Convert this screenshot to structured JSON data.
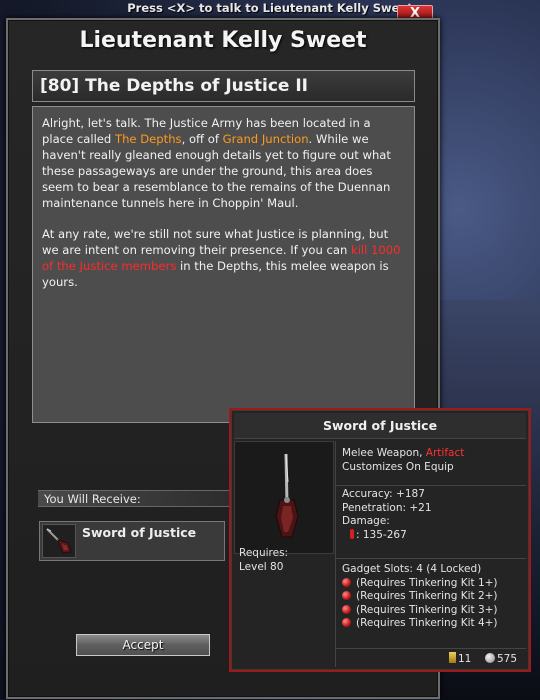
{
  "hint": "Press <X> to talk to Lieutenant Kelly Sweet",
  "close_label": "X",
  "npc_name": "Lieutenant Kelly Sweet",
  "mission": {
    "title": "[80] The Depths of Justice II",
    "para1_a": "Alright, let's talk. The Justice Army has been located in a place called ",
    "para1_loc1": "The Depths",
    "para1_b": ", off of ",
    "para1_loc2": "Grand Junction",
    "para1_c": ". While we haven't really gleaned enough details yet to figure out what these passageways are under the ground, this area does seem to bear a resemblance to the remains of the Duennan maintenance tunnels here in Choppin' Maul.",
    "para2_a": "At any rate, we're still not sure what Justice is planning, but we are intent on removing their presence. If you can ",
    "para2_objective": "kill 1000 of the Justice members",
    "para2_b": " in the Depths, this melee weapon is yours."
  },
  "reward": {
    "section_label": "You Will Receive:",
    "item_name": "Sword of Justice",
    "icon": "sword-icon"
  },
  "accept_label": "Accept",
  "tooltip": {
    "title": "Sword of Justice",
    "type_prefix": "Melee Weapon, ",
    "rarity": "Artifact",
    "customize": "Customizes On Equip",
    "accuracy": "Accuracy: +187",
    "penetration": "Penetration: +21",
    "damage_label": "Damage:",
    "damage_value": ": 135-267",
    "requires_label": "Requires:",
    "requires_value": "Level 80",
    "gadget_slots": "Gadget Slots: 4  (4 Locked)",
    "gadgets": [
      "(Requires Tinkering Kit 1+)",
      "(Requires Tinkering Kit 2+)",
      "(Requires Tinkering Kit 3+)",
      "(Requires Tinkering Kit 4+)"
    ],
    "token_count": "11",
    "price": "575"
  },
  "colors": {
    "highlight_location": "#ff9a1f",
    "highlight_objective": "#ff2a2a",
    "tooltip_border": "#a01818"
  }
}
